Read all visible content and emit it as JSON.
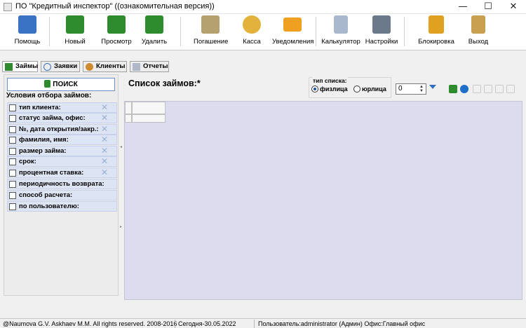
{
  "window": {
    "title": "ПО \"Кредитный инспектор\" ((ознакомительная версия))",
    "minimize": "—",
    "maximize": "☐",
    "close": "✕"
  },
  "toolbar": [
    {
      "label": "Помощь",
      "icon": "help-book-icon",
      "color": "#3a72c4"
    },
    {
      "label": "Новый",
      "icon": "new-money-icon",
      "color": "#2e8b2e"
    },
    {
      "label": "Просмотр",
      "icon": "view-money-icon",
      "color": "#2e8b2e"
    },
    {
      "label": "Удалить",
      "icon": "delete-money-icon",
      "color": "#2e8b2e"
    },
    {
      "label": "Погашение",
      "icon": "repayment-icon",
      "color": "#b5a070"
    },
    {
      "label": "Касса",
      "icon": "cash-coins-icon",
      "color": "#e3b23c"
    },
    {
      "label": "Уведомления",
      "icon": "envelope-icon",
      "color": "#f0a020"
    },
    {
      "label": "Калькулятор",
      "icon": "calculator-icon",
      "color": "#a9b8cc"
    },
    {
      "label": "Настройки",
      "icon": "tools-icon",
      "color": "#6a7a8a"
    },
    {
      "label": "Блокировка",
      "icon": "padlock-icon",
      "color": "#e0a020"
    },
    {
      "label": "Выход",
      "icon": "exit-door-icon",
      "color": "#c8a050"
    }
  ],
  "tabs": [
    {
      "label": "Займы",
      "icon": "money-icon",
      "active": true
    },
    {
      "label": "Заявки",
      "icon": "clock-icon",
      "active": false
    },
    {
      "label": "Клиенты",
      "icon": "clients-icon",
      "active": false
    },
    {
      "label": "Отчеты",
      "icon": "reports-icon",
      "active": false
    }
  ],
  "filters": {
    "search_label": "ПОИСК",
    "title": "Условия отбора займов:",
    "items": [
      {
        "label": "тип клиента:",
        "clearable": true
      },
      {
        "label": "статус займа, офис:",
        "clearable": true
      },
      {
        "label": "№, дата открытия/закр.:",
        "clearable": true
      },
      {
        "label": "фамилия, имя:",
        "clearable": true
      },
      {
        "label": "размер займа:",
        "clearable": true
      },
      {
        "label": "срок:",
        "clearable": true
      },
      {
        "label": "процентная ставка:",
        "clearable": true
      },
      {
        "label": "периодичность возврата:",
        "clearable": false
      },
      {
        "label": "способ расчета:",
        "clearable": false
      },
      {
        "label": "по пользователю:",
        "clearable": false
      }
    ],
    "clear_glyph": "✕"
  },
  "main": {
    "list_title": "Список займов:*",
    "list_type": {
      "label": "тип списка:",
      "options": [
        {
          "label": "физлица",
          "selected": true
        },
        {
          "label": "юрлица",
          "selected": false
        }
      ]
    },
    "spinner_value": "0"
  },
  "status": {
    "copyright": "@Naumova G.V. Askhaev M.M. All rights reserved. 2008-2016",
    "date": "Сегодня-30.05.2022",
    "user": "Пользователь:administrator (Админ) Офис:Главный офис"
  }
}
